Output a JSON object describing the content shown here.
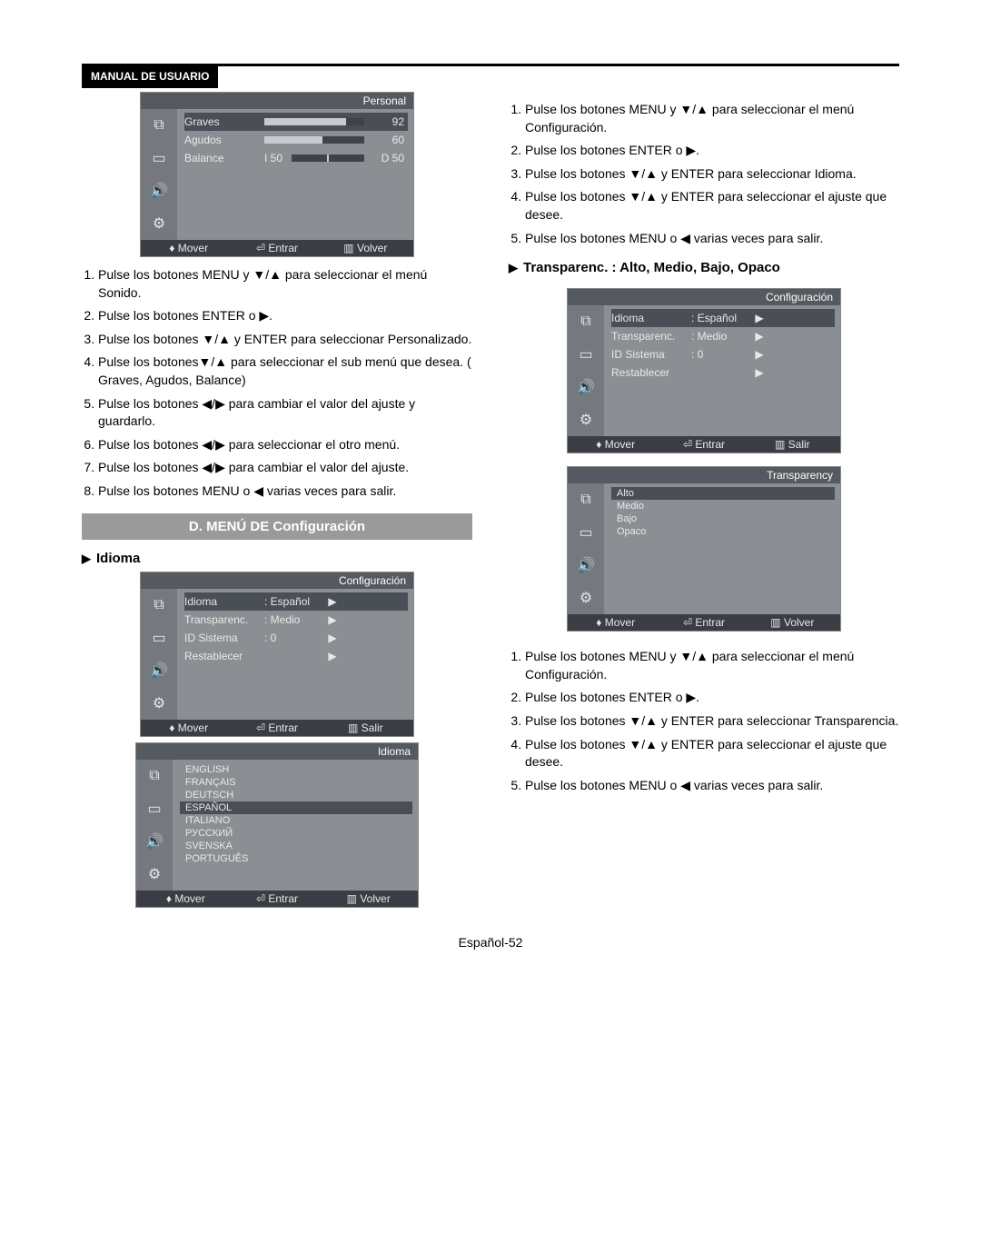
{
  "header": {
    "badge": "MANUAL DE USUARIO"
  },
  "page_number": "Español-52",
  "osd_sonido": {
    "title": "Personal",
    "rows": [
      {
        "label": "Graves",
        "value": "92",
        "fill": 82
      },
      {
        "label": "Agudos",
        "value": "60",
        "fill": 58
      },
      {
        "label": "Balance",
        "left": "I 50",
        "right": "D 50"
      }
    ],
    "footer": {
      "mover": "Mover",
      "entrar": "Entrar",
      "volver": "Volver"
    }
  },
  "steps_sonido": [
    "Pulse los botones MENU y ▼/▲ para seleccionar el menú Sonido.",
    "Pulse los botones ENTER o ▶.",
    "Pulse los botones ▼/▲ y ENTER para seleccionar Personalizado.",
    "Pulse los botones▼/▲ para seleccionar el sub menú que desea. ( Graves, Agudos, Balance)",
    "Pulse los botones ◀/▶ para cambiar el valor del ajuste y guardarlo.",
    "Pulse los botones ◀/▶ para seleccionar el otro menú.",
    "Pulse los botones ◀/▶ para cambiar el valor del ajuste.",
    "Pulse los botones MENU o ◀ varias veces para salir."
  ],
  "section_d_title": "D. MENÚ DE Configuración",
  "idioma_heading": "Idioma",
  "osd_config": {
    "title": "Configuración",
    "rows": [
      {
        "label": "Idioma",
        "value": ": Español",
        "arrow": "▶"
      },
      {
        "label": "Transparenc.",
        "value": ": Medio",
        "arrow": "▶"
      },
      {
        "label": "ID Sistema",
        "value": ": 0",
        "arrow": "▶"
      },
      {
        "label": "Restablecer",
        "value": "",
        "arrow": "▶"
      }
    ],
    "footer": {
      "mover": "Mover",
      "entrar": "Entrar",
      "salir": "Salir"
    }
  },
  "osd_idioma": {
    "title": "Idioma",
    "items": [
      "ENGLISH",
      "FRANÇAIS",
      "DEUTSCH",
      "ESPAÑOL",
      "ITALIANO",
      "РУССКИЙ",
      "SVENSKA",
      "PORTUGUÊS"
    ],
    "selected_index": 3,
    "footer": {
      "mover": "Mover",
      "entrar": "Entrar",
      "volver": "Volver"
    }
  },
  "steps_idioma": [
    "Pulse los botones MENU y ▼/▲ para seleccionar el menú Configuración.",
    "Pulse los botones ENTER o ▶.",
    "Pulse los botones ▼/▲ y ENTER para seleccionar Idioma.",
    "Pulse los botones ▼/▲ y ENTER para seleccionar el ajuste que desee.",
    "Pulse los botones MENU o ◀ varias veces para salir."
  ],
  "transparenc_heading": "Transparenc. : Alto, Medio, Bajo, Opaco",
  "osd_config2": {
    "title": "Configuración",
    "rows": [
      {
        "label": "Idioma",
        "value": ": Español",
        "arrow": "▶"
      },
      {
        "label": "Transparenc.",
        "value": ": Medio",
        "arrow": "▶"
      },
      {
        "label": "ID Sistema",
        "value": ": 0",
        "arrow": "▶"
      },
      {
        "label": "Restablecer",
        "value": "",
        "arrow": "▶"
      }
    ],
    "footer": {
      "mover": "Mover",
      "entrar": "Entrar",
      "salir": "Salir"
    }
  },
  "osd_transparency": {
    "title": "Transparency",
    "items": [
      "Alto",
      "Medio",
      "Bajo",
      "Opaco"
    ],
    "selected_index": 0,
    "footer": {
      "mover": "Mover",
      "entrar": "Entrar",
      "volver": "Volver"
    }
  },
  "steps_transparenc": [
    "Pulse los botones MENU y ▼/▲ para seleccionar el menú Configuración.",
    "Pulse los botones ENTER o ▶.",
    "Pulse los botones ▼/▲ y ENTER para seleccionar Transparencia.",
    "Pulse los botones ▼/▲ y ENTER para seleccionar el ajuste que desee.",
    "Pulse los botones MENU o ◀ varias veces para salir."
  ],
  "icons": {
    "mover": "♦",
    "entrar": "⏎",
    "salir": "▥",
    "volver": "▥"
  }
}
